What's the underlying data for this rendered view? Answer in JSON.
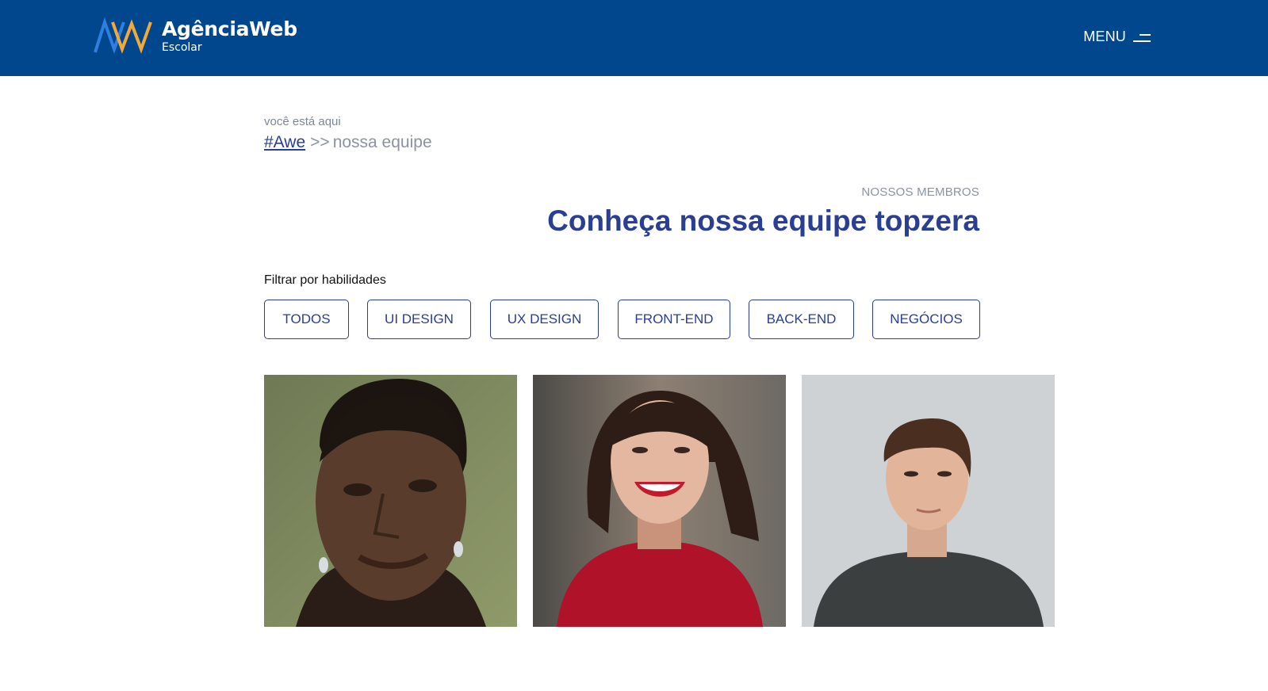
{
  "header": {
    "brand_name": "AgênciaWeb",
    "brand_sub": "Escolar",
    "logo_icon": "aw-zigzag-logo",
    "menu_label": "MENU",
    "menu_icon": "hamburger-icon",
    "bg_color": "#01478e"
  },
  "breadcrumb": {
    "caption": "você está aqui",
    "home": "#Awe",
    "separator": ">>",
    "current": "nossa equipe"
  },
  "section": {
    "eyebrow": "NOSSOS MEMBROS",
    "title": "Conheça nossa equipe topzera",
    "accent_color": "#2a3e94"
  },
  "filter": {
    "label": "Filtrar por habilidades",
    "buttons": [
      "TODOS",
      "UI DESIGN",
      "UX DESIGN",
      "FRONT-END",
      "BACK-END",
      "NEGÓCIOS"
    ]
  },
  "members": [
    {
      "photo": "portrait-man-braids"
    },
    {
      "photo": "portrait-woman-red-sweater"
    },
    {
      "photo": "portrait-man-dark-shirt"
    }
  ]
}
